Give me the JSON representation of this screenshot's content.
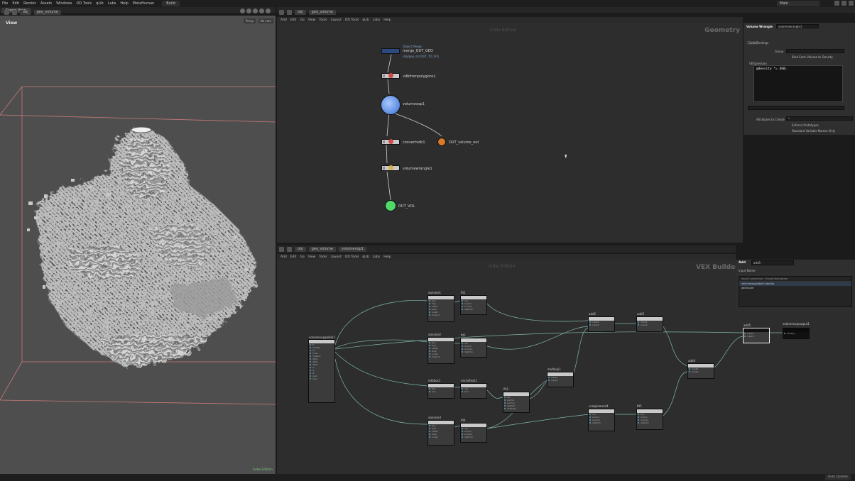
{
  "menubar": {
    "items": [
      "File",
      "Edit",
      "Render",
      "Assets",
      "Windows",
      "OD Tools",
      "qLib",
      "Labs",
      "Help",
      "MetaHuman"
    ],
    "desktop": "Build",
    "main_label": "Main"
  },
  "viewport": {
    "tab": "Scene View",
    "path": [
      "obj",
      "geo_volume"
    ],
    "label": "View",
    "persp_btn": "Persp",
    "nocam_btn": "No cam",
    "footer": "Indie Edition"
  },
  "network": {
    "path": [
      "obj",
      "geo_volume"
    ],
    "menu": [
      "Add",
      "Edit",
      "Go",
      "View",
      "Tools",
      "Layout",
      "OD Tools",
      "qLib",
      "Labs",
      "Help"
    ],
    "title": "Geometry",
    "subtitle": "Indie Edition",
    "nodes": [
      {
        "name": "merge_OUT_GEO",
        "comment": "Object Merge",
        "sub": "/obj/geo_src/OUT_TO_VOL"
      },
      {
        "name": "vdbfrompolygons1"
      },
      {
        "name": "volumevop1"
      },
      {
        "name": "convertvdb1"
      },
      {
        "name": "volumewrangle1"
      },
      {
        "name": "OUT_VOL"
      },
      {
        "name": "OUT_volume_out"
      }
    ]
  },
  "vex": {
    "path": [
      "obj",
      "geo_volume",
      "volumevop1"
    ],
    "menu": [
      "Add",
      "Edit",
      "Go",
      "View",
      "Tools",
      "Layout",
      "OD Tools",
      "qLib",
      "Labs",
      "Help"
    ],
    "title": "VEX Builder",
    "subtitle": "Indie Edition",
    "nodes": {
      "globals": "volumevopglobal1",
      "aanoise1": "aanoise1",
      "aanoise2": "aanoise2",
      "aanoise3": "aanoise3",
      "fit1": "fit1",
      "fit2": "fit2",
      "fit3": "fit3",
      "fit4": "fit4",
      "fit5": "fit5",
      "relbbox1": "relbbox1",
      "vectofloat1": "vectofloat1",
      "multiply1": "multiply1",
      "add2": "add2",
      "add3": "add3",
      "add4": "add4",
      "add5": "add5",
      "complem": "complement4",
      "output": "volumevopoutput1"
    }
  },
  "parms": {
    "node_type": "Volume Wrangle",
    "node_name": "volumewrangle1",
    "tabs": [
      "Code",
      "Bindings"
    ],
    "group_label": "Group",
    "bind_label": "Bind Each Volume to Density",
    "vex_label": "VEXpression",
    "code": "@density *= 460;",
    "vexpr_label": "VEXpression",
    "attrs_label": "Attributes to Create",
    "attrs_value": "*",
    "enforce": "Enforce Prototypes",
    "standard": "Standard Variable Names Only"
  },
  "vexparms": {
    "node_type": "Add",
    "node_name": "add5",
    "input_label": "Input Name",
    "items": [
      "Input Connection / Group Description",
      "volumevopglobal1:density",
      "add4:sum"
    ]
  },
  "status": {
    "right": "Auto Update"
  },
  "colors": {
    "viewport_bg": "#4e4e4e",
    "node_body": "#c9c9c9",
    "wire": "#8fcfc2",
    "out_green": "#4fd96a",
    "out_orange": "#d97a2a",
    "vop_blue": "#5a8ee0",
    "box": "#c97a7a"
  }
}
